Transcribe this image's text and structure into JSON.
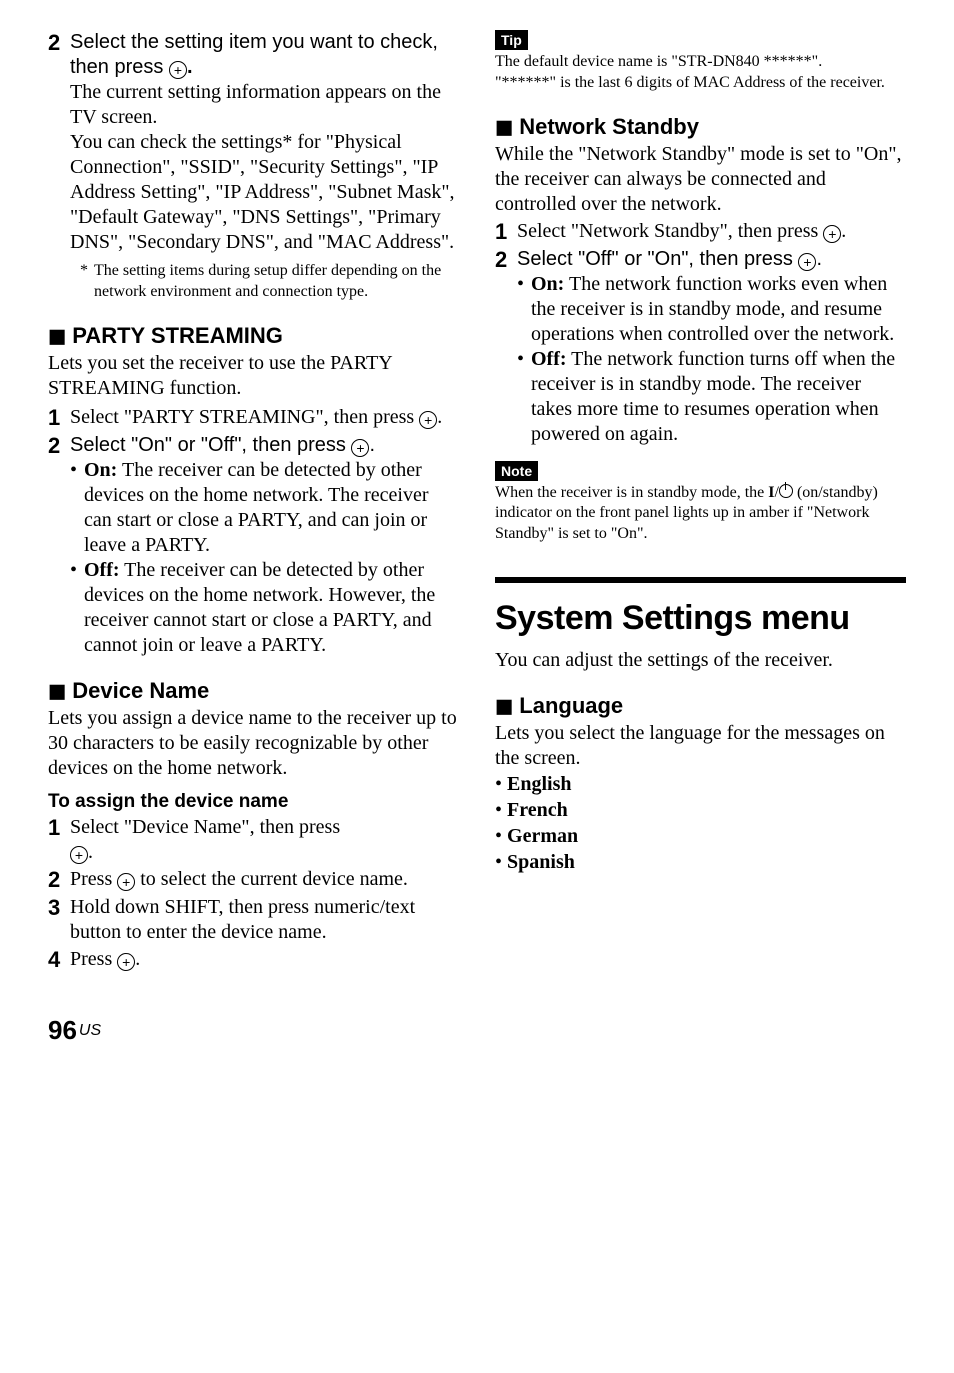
{
  "left": {
    "step2_lead": "Select the setting item you want to check, then press ",
    "step2_period": ".",
    "step2_body1": "The current setting information appears on the TV screen.",
    "step2_body2": "You can check the settings* for \"Physical Connection\", \"SSID\", \"Security Settings\", \"IP Address Setting\", \"IP Address\", \"Subnet Mask\", \"Default Gateway\", \"DNS Settings\", \"Primary DNS\", \"Secondary DNS\", and \"MAC Address\".",
    "step2_footnote_ast": "*",
    "step2_footnote": "The setting items during setup differ depending on the network environment and connection type.",
    "party_heading": "PARTY STREAMING",
    "party_intro": "Lets you set the receiver to use the PARTY STREAMING function.",
    "party_step1": "Select \"PARTY STREAMING\", then press ",
    "party_step2_a": "Select \"On\" or \"Off\", then press ",
    "party_on_label": "On:",
    "party_on_text": " The receiver can be detected by other devices on the home network. The receiver can start or close a PARTY, and can join or leave a PARTY.",
    "party_off_label": "Off:",
    "party_off_text": " The receiver can be detected by other devices on the home network. However, the receiver cannot start or close a PARTY, and cannot join or leave a PARTY.",
    "device_heading": "Device Name",
    "device_intro": "Lets you assign a device name to the receiver up to 30 characters to be easily recognizable by other devices on the home network.",
    "assign_heading": "To assign the device name",
    "assign_step1": "Select \"Device Name\", then press ",
    "assign_step2_a": "Press ",
    "assign_step2_b": " to select the current device name.",
    "assign_step3": "Hold down SHIFT, then press numeric/text button to enter the device name.",
    "assign_step4_a": "Press "
  },
  "right": {
    "tip_label": "Tip",
    "tip_line1": "The default device name is \"STR-DN840 ******\".",
    "tip_line2": "\"******\" is the last 6 digits of MAC Address of the receiver.",
    "net_heading": "Network Standby",
    "net_intro": "While the \"Network Standby\" mode is set to \"On\", the receiver can always be connected and controlled over the network.",
    "net_step1": "Select \"Network Standby\", then press ",
    "net_step2_a": "Select \"Off\" or \"On\", then press ",
    "net_on_label": "On:",
    "net_on_text": " The network function works even when the receiver is in standby mode, and resume operations when controlled over the network.",
    "net_off_label": "Off:",
    "net_off_text": " The network function turns off when the receiver is in standby mode. The receiver takes more time to resumes operation when powered on again.",
    "note_label": "Note",
    "note_text_a": "When the receiver is in standby mode, the ",
    "note_text_b": " (on/standby) indicator on the front panel lights up in amber if \"Network Standby\" is set to \"On\".",
    "sys_title": "System Settings menu",
    "sys_intro": "You can adjust the settings of the receiver.",
    "lang_heading": "Language",
    "lang_intro": "Lets you select the language for the messages on the screen.",
    "langs": [
      "English",
      "French",
      "German",
      "Spanish"
    ]
  },
  "pagenum": "96",
  "pagenum_suffix": "US",
  "nums": {
    "n1": "1",
    "n2": "2",
    "n3": "3",
    "n4": "4"
  },
  "glyph": {
    "bullet": "•",
    "square": "◼",
    "period": ".",
    "slash": "/",
    "I": "I"
  }
}
